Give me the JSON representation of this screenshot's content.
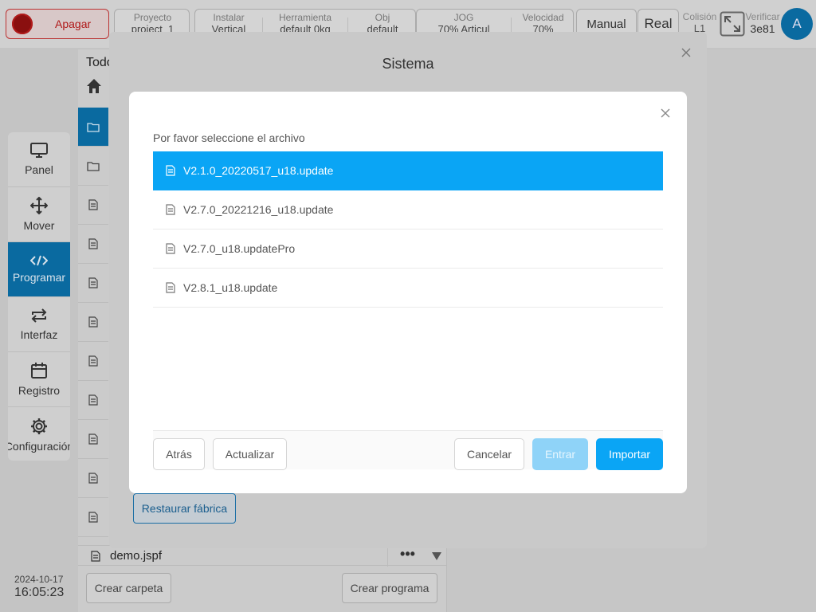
{
  "topbar": {
    "stop_label": "Apagar",
    "status": [
      {
        "title": "Proyecto",
        "value": "project_1"
      },
      {
        "title": "Instalar",
        "value": "Vertical"
      },
      {
        "title": "Herramienta",
        "value": "default    0kg"
      },
      {
        "title": "Obj",
        "value": "default"
      },
      {
        "title": "JOG",
        "value": "70%    Articul"
      },
      {
        "title": "Velocidad",
        "value": "70%"
      }
    ],
    "mode_label": "Manual",
    "real_label": "Real",
    "collision_title": "Colisión",
    "collision_value": "L1",
    "verify_title": "Verificar",
    "verify_value": "3e81",
    "avatar_letter": "A"
  },
  "sidebar": {
    "items": [
      {
        "label": "Panel",
        "icon": "monitor-icon"
      },
      {
        "label": "Mover",
        "icon": "move-icon"
      },
      {
        "label": "Programar",
        "icon": "code-icon"
      },
      {
        "label": "Interfaz",
        "icon": "swap-icon"
      },
      {
        "label": "Registro",
        "icon": "calendar-icon"
      },
      {
        "label": "Configuración",
        "icon": "gear-icon"
      }
    ],
    "date": "2024-10-17",
    "time": "16:05:23"
  },
  "files_panel": {
    "title": "Todo",
    "demo_file": "demo.jspf",
    "more_label": "•••",
    "create_folder_label": "Crear carpeta",
    "create_program_label": "Crear programa"
  },
  "system_dialog": {
    "title": "Sistema",
    "restore_label": "Restaurar fábrica"
  },
  "file_modal": {
    "prompt": "Por favor seleccione el archivo",
    "files": [
      "V2.1.0_20220517_u18.update",
      "V2.7.0_20221216_u18.update",
      "V2.7.0_u18.updatePro",
      "V2.8.1_u18.update"
    ],
    "selected_index": 0,
    "back_label": "Atrás",
    "refresh_label": "Actualizar",
    "cancel_label": "Cancelar",
    "enter_label": "Entrar",
    "import_label": "Importar"
  },
  "colors": {
    "accent": "#0aa5f5",
    "accent_disabled": "#8fd3f8",
    "stop_red": "#b01818"
  }
}
